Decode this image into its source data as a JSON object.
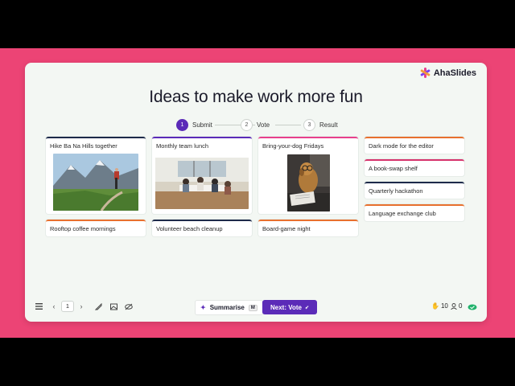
{
  "brand": {
    "name": "AhaSlides",
    "colors": [
      "#e8408c",
      "#7a3ff0",
      "#f29a3c"
    ]
  },
  "slide": {
    "title": "Ideas to make work more fun"
  },
  "stepper": {
    "steps": [
      {
        "num": "1",
        "label": "Submit",
        "active": true
      },
      {
        "num": "2",
        "label": "Vote",
        "active": false
      },
      {
        "num": "3",
        "label": "Result",
        "active": false
      }
    ]
  },
  "ideas": [
    {
      "text": "Hike Ba Na Hills together",
      "accent": "#1d2a4a",
      "image": "mountain-hiker-photo"
    },
    {
      "text": "Rooftop coffee mornings",
      "accent": "#e8702e"
    },
    {
      "text": "Monthly team lunch",
      "accent": "#5b2bb8",
      "image": "team-lunch-photo"
    },
    {
      "text": "Volunteer beach cleanup",
      "accent": "#1d2a4a"
    },
    {
      "text": "Bring-your-dog Fridays",
      "accent": "#e8408c",
      "image": "dog-reading-photo"
    },
    {
      "text": "Board-game night",
      "accent": "#e8702e"
    },
    {
      "text": "Dark mode for the editor",
      "accent": "#e8702e"
    },
    {
      "text": "A book-swap shelf",
      "accent": "#d6336c"
    },
    {
      "text": "Quarterly hackathon",
      "accent": "#1d2a4a"
    },
    {
      "text": "Language exchange club",
      "accent": "#e8702e"
    }
  ],
  "toolbar": {
    "page": "1",
    "summarise_label": "Summarise",
    "summarise_shortcut": "M",
    "next_label": "Next: Vote",
    "reactions_count": "10",
    "participants_count": "0",
    "icons": [
      "menu-icon",
      "chevron-left-icon",
      "chevron-right-icon",
      "brush-icon",
      "image-icon",
      "hide-icon",
      "sparkle-icon",
      "hand-icon",
      "user-icon",
      "cloud-check-icon"
    ]
  }
}
